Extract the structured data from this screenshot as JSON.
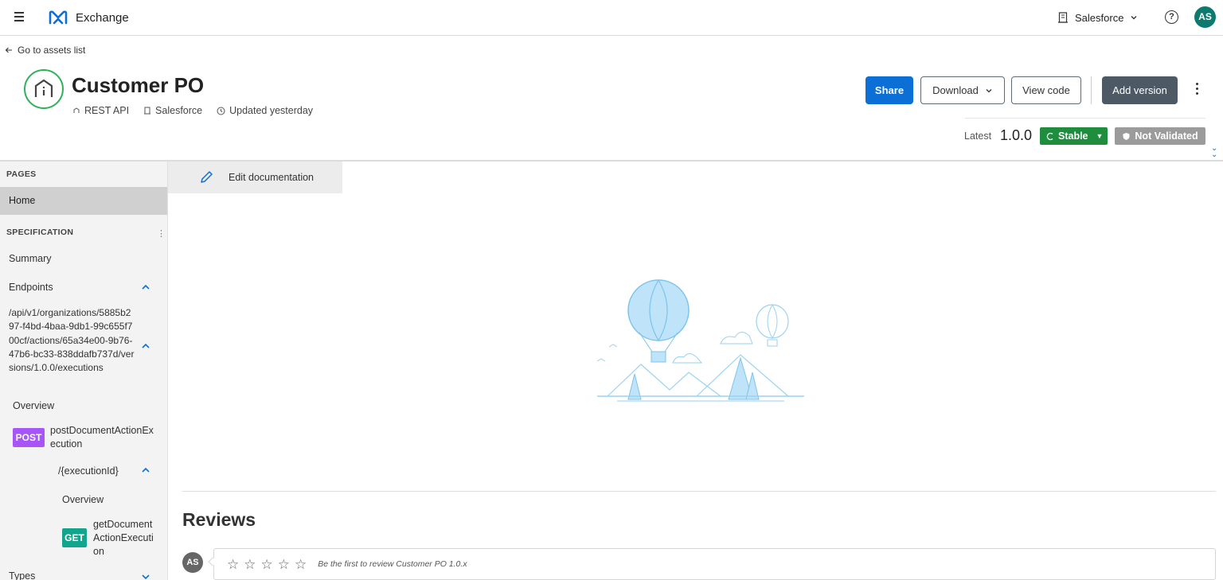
{
  "topbar": {
    "app_name": "Exchange",
    "org_name": "Salesforce",
    "help_glyph": "?",
    "user_initials": "AS",
    "icons": [
      "hamburger-icon",
      "exchange-logo-icon",
      "building-icon",
      "chevron-down-icon",
      "help-icon"
    ]
  },
  "header": {
    "back_label": "Go to assets list",
    "title": "Customer PO",
    "meta": {
      "type": "REST API",
      "org": "Salesforce",
      "updated": "Updated yesterday"
    },
    "buttons": {
      "share": "Share",
      "download": "Download",
      "view_code": "View code",
      "add_version": "Add version"
    },
    "latest_label": "Latest",
    "latest_version": "1.0.0",
    "stable_label": "Stable",
    "validation_label": "Not Validated"
  },
  "sidebar": {
    "pages_heading": "PAGES",
    "home": "Home",
    "spec_heading": "SPECIFICATION",
    "summary": "Summary",
    "endpoints": "Endpoints",
    "endpoint_path": "/api/v1/organizations/5885b297-f4bd-4baa-9db1-99c655f700cf/actions/65a34e00-9b76-47b6-bc33-838ddafb737d/versions/1.0.0/executions",
    "overview_1": "Overview",
    "post_method": "POST",
    "post_operation": "postDocumentActionExecution",
    "sub_path": "/{executionId}",
    "overview_2": "Overview",
    "get_method": "GET",
    "get_operation": "getDocumentActionExecution",
    "types": "Types"
  },
  "main": {
    "edit_doc_label": "Edit documentation",
    "reviews_title": "Reviews",
    "reviewer_initials": "AS",
    "review_prompt": "Be the first to review Customer PO 1.0.x",
    "star_count": 5
  },
  "colors": {
    "share_blue": "#0b6fd6",
    "stable_green": "#1e8d3e",
    "post_purple": "#a855f7",
    "get_teal": "#12a58d",
    "avatar_teal": "#0d7a6e"
  }
}
